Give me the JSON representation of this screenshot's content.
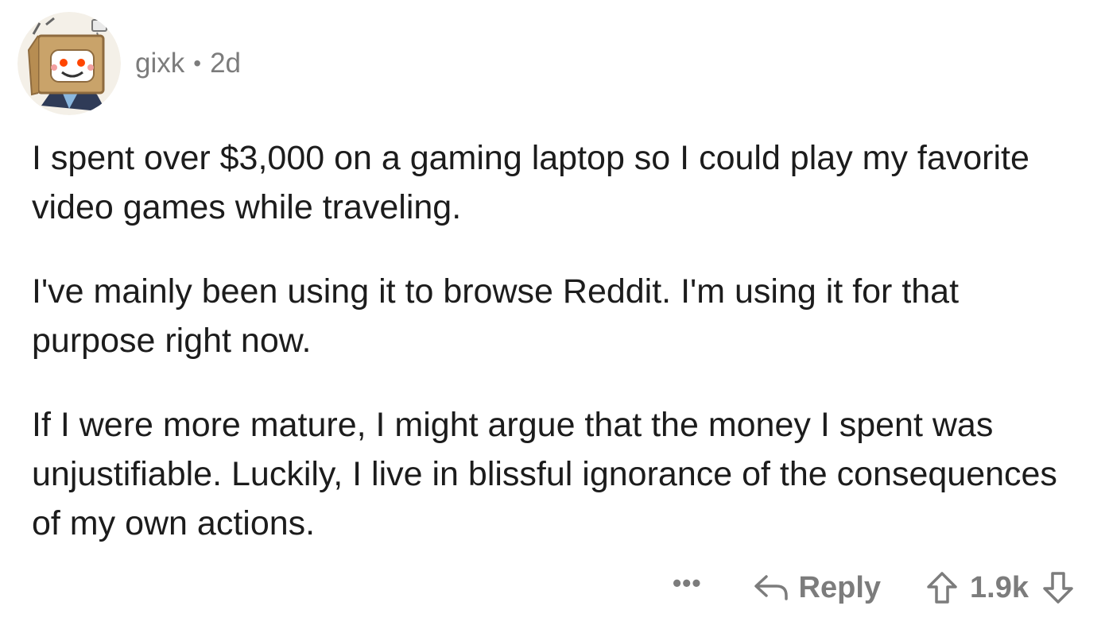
{
  "comment": {
    "author": "gixk",
    "separator": "•",
    "age": "2d",
    "paragraphs": [
      "I spent over $3,000 on a gaming laptop so I could play my favorite video games while traveling.",
      "I've mainly been using it to browse Reddit. I'm using it for that purpose right now.",
      "If I were more mature, I might argue that the money I spent was unjustifiable. Luckily, I live in blissful ignorance of the consequences of my own actions."
    ]
  },
  "actions": {
    "more_label": "•••",
    "reply_label": "Reply",
    "score": "1.9k"
  },
  "icons": {
    "avatar": "snoo-box-head-avatar",
    "reply": "reply-arrow-icon",
    "upvote": "upvote-arrow-icon",
    "downvote": "downvote-arrow-icon"
  },
  "colors": {
    "text": "#1c1c1c",
    "muted": "#7c7c7c",
    "background": "#ffffff"
  }
}
